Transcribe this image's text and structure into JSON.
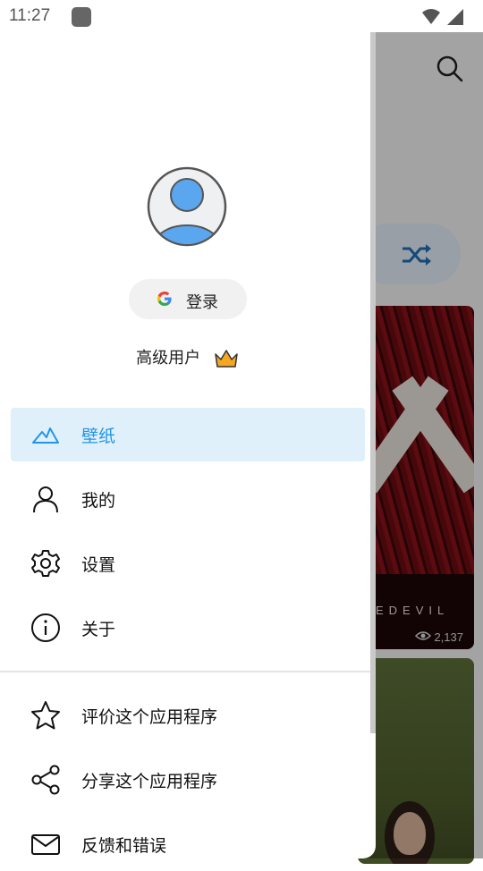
{
  "status_bar": {
    "time": "11:27"
  },
  "background": {
    "card_title": "EDEVIL",
    "card_views": "2,137"
  },
  "drawer": {
    "login_label": "登录",
    "premium_label": "高级用户",
    "menu": [
      {
        "label": "壁纸",
        "icon": "wallpaper-icon",
        "active": true
      },
      {
        "label": "我的",
        "icon": "person-icon"
      },
      {
        "label": "设置",
        "icon": "gear-icon"
      },
      {
        "label": "关于",
        "icon": "info-icon"
      }
    ],
    "secondary_menu": [
      {
        "label": "评价这个应用程序",
        "icon": "star-icon"
      },
      {
        "label": "分享这个应用程序",
        "icon": "share-icon"
      },
      {
        "label": "反馈和错误",
        "icon": "mail-icon"
      }
    ]
  },
  "colors": {
    "accent": "#2196e8",
    "active_bg": "#e0f0fb",
    "crown": "#f5a623"
  }
}
